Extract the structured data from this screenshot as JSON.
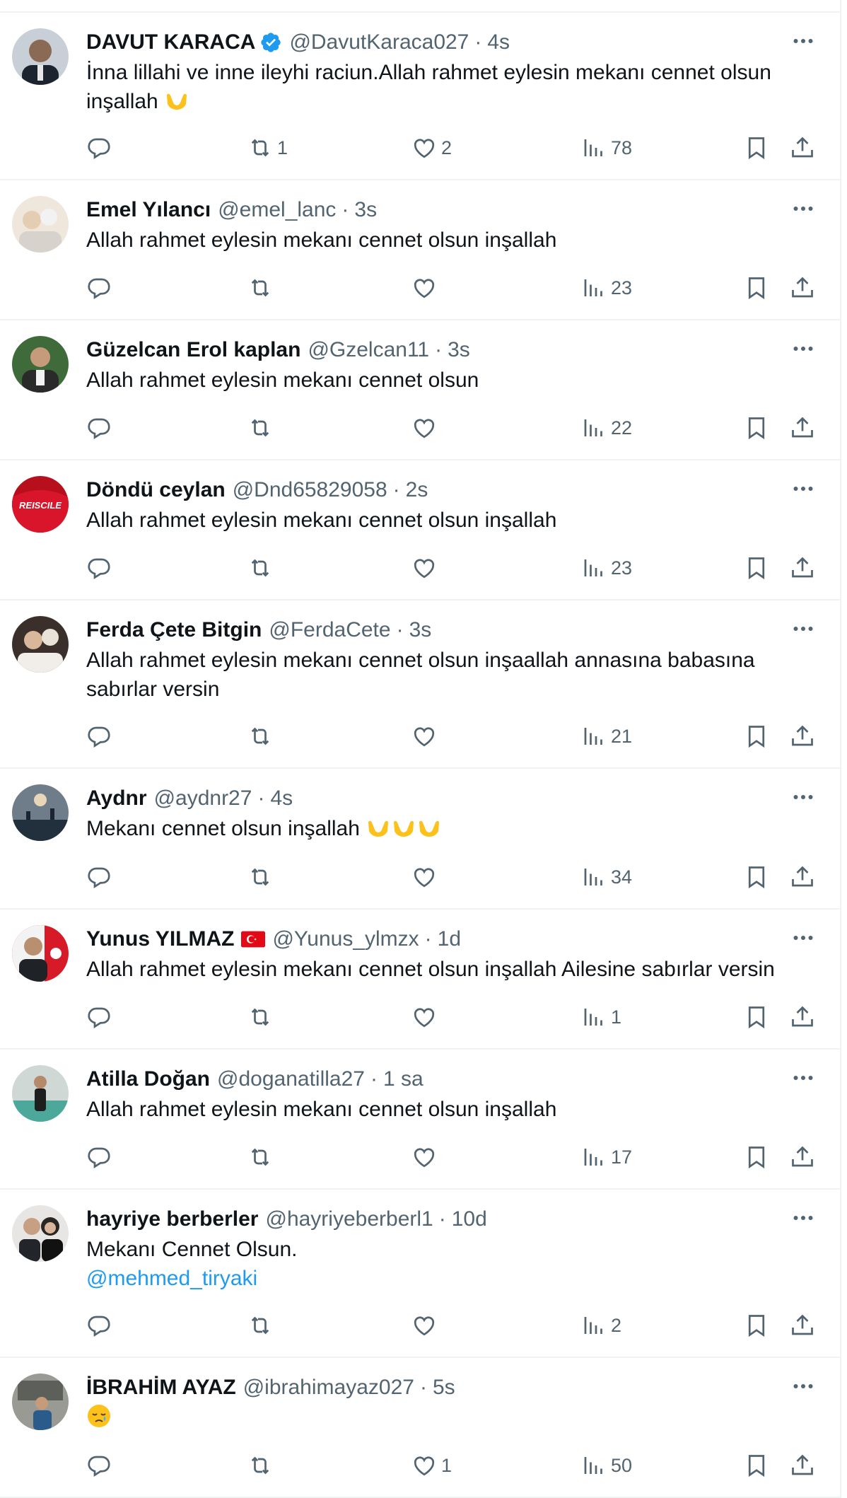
{
  "colors": {
    "accent": "#1d9bf0",
    "text": "#0f1419",
    "muted": "#536471",
    "divider": "#eff3f4",
    "emoji": "#fcc21b"
  },
  "tweets": [
    {
      "name": "DAVUT KARACA",
      "verified": true,
      "handle": "@DavutKaraca027",
      "dot": "·",
      "time": "4s",
      "text": "İnna lillahi ve inne ileyhi raciun.Allah rahmet eylesin mekanı cennet olsun inşallah",
      "emoji_icons": [
        "palms-up-together-emoji"
      ],
      "replies": "",
      "retweets": "1",
      "likes": "2",
      "views": "78"
    },
    {
      "name": "Emel Yılancı",
      "handle": "@emel_lanc",
      "dot": "·",
      "time": "3s",
      "text": "Allah rahmet eylesin mekanı cennet olsun inşallah",
      "replies": "",
      "retweets": "",
      "likes": "",
      "views": "23"
    },
    {
      "name": "Güzelcan Erol kaplan",
      "handle": "@Gzelcan11",
      "dot": "·",
      "time": "3s",
      "text": "Allah rahmet eylesin mekanı cennet olsun",
      "replies": "",
      "retweets": "",
      "likes": "",
      "views": "22"
    },
    {
      "name": "Döndü ceylan",
      "handle": "@Dnd65829058",
      "dot": "·",
      "time": "2s",
      "text": "Allah rahmet eylesin mekanı cennet olsun inşallah",
      "replies": "",
      "retweets": "",
      "likes": "",
      "views": "23",
      "avatar_text": "REISCILE"
    },
    {
      "name": "Ferda Çete Bitgin",
      "handle": "@FerdaCete",
      "dot": "·",
      "time": "3s",
      "text": "Allah rahmet eylesin mekanı cennet olsun inşaallah annasına babasına sabırlar versin",
      "replies": "",
      "retweets": "",
      "likes": "",
      "views": "21"
    },
    {
      "name": "Aydnr",
      "handle": "@aydnr27",
      "dot": "·",
      "time": "4s",
      "text": "Mekanı cennet olsun inşallah",
      "emoji_icons": [
        "palms-up-together-emoji",
        "palms-up-together-emoji",
        "palms-up-together-emoji"
      ],
      "replies": "",
      "retweets": "",
      "likes": "",
      "views": "34"
    },
    {
      "name": "Yunus YILMAZ",
      "flag": true,
      "handle": "@Yunus_ylmzx",
      "dot": "·",
      "time": "1d",
      "text": "Allah rahmet eylesin mekanı cennet olsun inşallah Ailesine sabırlar versin",
      "replies": "",
      "retweets": "",
      "likes": "",
      "views": "1"
    },
    {
      "name": "Atilla Doğan",
      "handle": "@doganatilla27",
      "dot": "·",
      "time": "1 sa",
      "text": "Allah rahmet eylesin mekanı cennet olsun inşallah",
      "replies": "",
      "retweets": "",
      "likes": "",
      "views": "17"
    },
    {
      "name": "hayriye berberler",
      "handle": "@hayriyeberberl1",
      "dot": "·",
      "time": "10d",
      "text": "Mekanı Cennet Olsun.",
      "mention": "@mehmed_tiryaki",
      "replies": "",
      "retweets": "",
      "likes": "",
      "views": "2"
    },
    {
      "name": "İBRAHİM AYAZ",
      "handle": "@ibrahimayaz027",
      "dot": "·",
      "time": "5s",
      "text": "",
      "emoji_icons": [
        "sad-relieved-face-emoji"
      ],
      "replies": "",
      "retweets": "",
      "likes": "1",
      "views": "50"
    }
  ]
}
